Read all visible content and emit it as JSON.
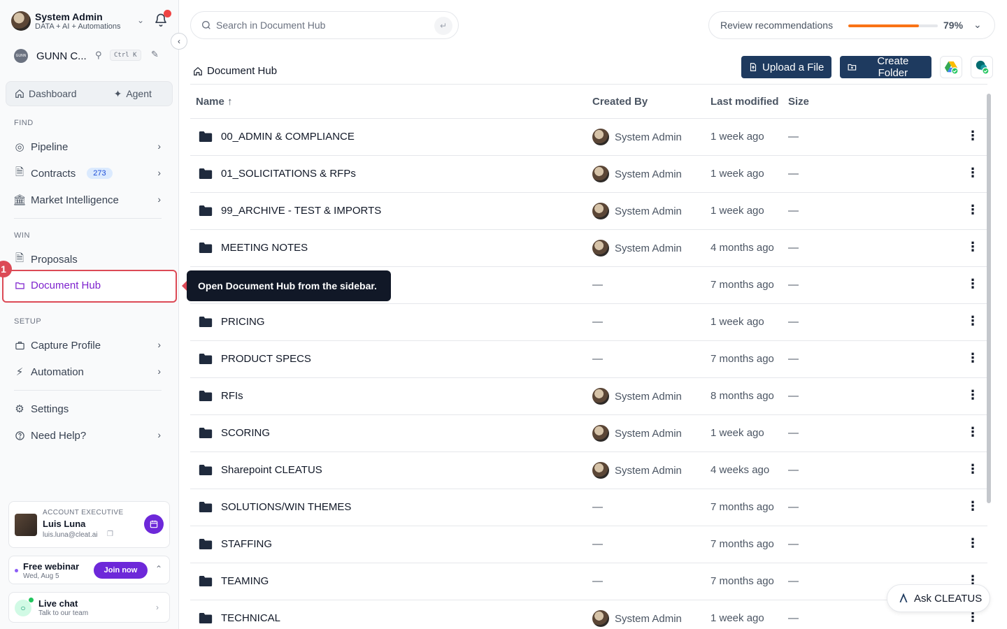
{
  "user": {
    "name": "System Admin",
    "subtitle": "DATA + AI + Automations"
  },
  "org": {
    "logo_text": "GUNN",
    "name": "GUNN C...",
    "shortcut": "Ctrl K"
  },
  "segments": {
    "dashboard": "Dashboard",
    "agent": "Agent"
  },
  "sections": {
    "find": "FIND",
    "win": "WIN",
    "setup": "SETUP"
  },
  "nav": {
    "pipeline": "Pipeline",
    "contracts": "Contracts",
    "contracts_badge": "273",
    "market_intelligence": "Market Intelligence",
    "proposals": "Proposals",
    "document_hub": "Document Hub",
    "capture_profile": "Capture Profile",
    "automation": "Automation",
    "settings": "Settings",
    "need_help": "Need Help?"
  },
  "step_badge": "1",
  "tooltip": "Open Document Hub from the sidebar.",
  "account_exec": {
    "label": "ACCOUNT EXECUTIVE",
    "name": "Luis Luna",
    "email": "luis.luna@cleat.ai"
  },
  "webinar": {
    "title": "Free webinar",
    "date": "Wed, Aug 5",
    "button": "Join now"
  },
  "chat": {
    "title": "Live chat",
    "subtitle": "Talk to our team"
  },
  "search": {
    "placeholder": "Search in Document Hub"
  },
  "review": {
    "label": "Review recommendations",
    "percent": "79%",
    "progress": 0.79
  },
  "breadcrumb": "Document Hub",
  "actions": {
    "upload": "Upload a File",
    "create_folder": "Create Folder"
  },
  "table": {
    "columns": {
      "name": "Name",
      "created_by": "Created By",
      "last_modified": "Last modified",
      "size": "Size"
    },
    "rows": [
      {
        "name": "00_ADMIN & COMPLIANCE",
        "created_by": "System Admin",
        "modified": "1 week ago",
        "size": "—"
      },
      {
        "name": "01_SOLICITATIONS & RFPs",
        "created_by": "System Admin",
        "modified": "1 week ago",
        "size": "—"
      },
      {
        "name": "99_ARCHIVE - TEST & IMPORTS",
        "created_by": "System Admin",
        "modified": "1 week ago",
        "size": "—"
      },
      {
        "name": "MEETING NOTES",
        "created_by": "System Admin",
        "modified": "4 months ago",
        "size": "—"
      },
      {
        "name": "",
        "created_by": "—",
        "modified": "7 months ago",
        "size": "—"
      },
      {
        "name": "PRICING",
        "created_by": "—",
        "modified": "1 week ago",
        "size": "—"
      },
      {
        "name": "PRODUCT SPECS",
        "created_by": "—",
        "modified": "7 months ago",
        "size": "—"
      },
      {
        "name": "RFIs",
        "created_by": "System Admin",
        "modified": "8 months ago",
        "size": "—"
      },
      {
        "name": "SCORING",
        "created_by": "System Admin",
        "modified": "1 week ago",
        "size": "—"
      },
      {
        "name": "Sharepoint CLEATUS",
        "created_by": "System Admin",
        "modified": "4 weeks ago",
        "size": "—"
      },
      {
        "name": "SOLUTIONS/WIN THEMES",
        "created_by": "—",
        "modified": "7 months ago",
        "size": "—"
      },
      {
        "name": "STAFFING",
        "created_by": "—",
        "modified": "7 months ago",
        "size": "—"
      },
      {
        "name": "TEAMING",
        "created_by": "—",
        "modified": "7 months ago",
        "size": "—"
      },
      {
        "name": "TECHNICAL",
        "created_by": "System Admin",
        "modified": "1 week ago",
        "size": "—"
      }
    ]
  },
  "ask": "Ask CLEATUS",
  "colors": {
    "primary": "#1e3a5f",
    "accent": "#7e22ce",
    "highlight": "#dc4a56",
    "progress": "#f97316"
  }
}
